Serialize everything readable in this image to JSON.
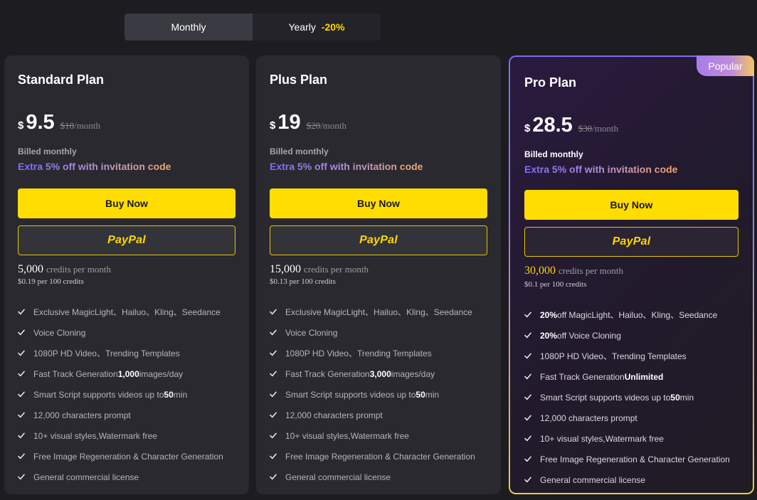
{
  "billing_toggle": {
    "monthly_label": "Monthly",
    "yearly_label": "Yearly",
    "yearly_discount": "-20%",
    "selected": "Monthly"
  },
  "colors": {
    "accent_yellow": "#ffdd00",
    "card_bg": "#29292f",
    "page_bg": "#1c1c21"
  },
  "plans": [
    {
      "name": "Standard Plan",
      "currency": "$",
      "price": "9.5",
      "old_price": "$10",
      "old_suffix": "/month",
      "billed": "Billed monthly",
      "invite_text": "Extra 5% off with invitation code",
      "buy_label": "Buy Now",
      "paypal_label": "PayPal",
      "credits_amount": "5,000",
      "credits_label": "credits per month",
      "per_credits": "$0.19 per 100 credits",
      "features": [
        {
          "pre": "Exclusive MagicLight、Hailuo、Kling、Seedance"
        },
        {
          "pre": "Voice Cloning"
        },
        {
          "pre": "1080P HD Video、Trending Templates"
        },
        {
          "pre": "Fast Track Generation ",
          "bold": "1,000",
          "post": " images/day"
        },
        {
          "pre": "Smart Script supports videos up to ",
          "bold": "50",
          "post": " min"
        },
        {
          "pre": "12,000 characters prompt"
        },
        {
          "pre": "10+ visual styles,Watermark free"
        },
        {
          "pre": "Free Image Regeneration & Character Generation"
        },
        {
          "pre": "General commercial license"
        }
      ]
    },
    {
      "name": "Plus Plan",
      "currency": "$",
      "price": "19",
      "old_price": "$20",
      "old_suffix": "/month",
      "billed": "Billed monthly",
      "invite_text": "Extra 5% off with invitation code",
      "buy_label": "Buy Now",
      "paypal_label": "PayPal",
      "credits_amount": "15,000",
      "credits_label": "credits per month",
      "per_credits": "$0.13 per 100 credits",
      "features": [
        {
          "pre": "Exclusive MagicLight、Hailuo、Kling、Seedance"
        },
        {
          "pre": "Voice Cloning"
        },
        {
          "pre": "1080P HD Video、Trending Templates"
        },
        {
          "pre": "Fast Track Generation ",
          "bold": "3,000",
          "post": " images/day"
        },
        {
          "pre": "Smart Script supports videos up to ",
          "bold": "50",
          "post": " min"
        },
        {
          "pre": "12,000 characters prompt"
        },
        {
          "pre": "10+ visual styles,Watermark free"
        },
        {
          "pre": "Free Image Regeneration & Character Generation"
        },
        {
          "pre": "General commercial license"
        }
      ]
    },
    {
      "name": "Pro Plan",
      "badge": "Popular",
      "currency": "$",
      "price": "28.5",
      "old_price": "$30",
      "old_suffix": "/month",
      "billed": "Billed monthly",
      "invite_text": "Extra 5% off with invitation code",
      "buy_label": "Buy Now",
      "paypal_label": "PayPal",
      "credits_amount": "30,000",
      "credits_label": "credits per month",
      "per_credits": "$0.1 per 100 credits",
      "features": [
        {
          "bold_first": "20%",
          "post": " off MagicLight、Hailuo、Kling、Seedance"
        },
        {
          "bold_first": "20%",
          "post": " off Voice Cloning"
        },
        {
          "pre": "1080P HD Video、Trending Templates"
        },
        {
          "pre": "Fast Track Generation ",
          "bold": "Unlimited"
        },
        {
          "pre": "Smart Script supports videos up to ",
          "bold": "50",
          "post": " min"
        },
        {
          "pre": "12,000 characters prompt"
        },
        {
          "pre": "10+ visual styles,Watermark free"
        },
        {
          "pre": "Free Image Regeneration & Character Generation"
        },
        {
          "pre": "General commercial license"
        }
      ]
    }
  ]
}
